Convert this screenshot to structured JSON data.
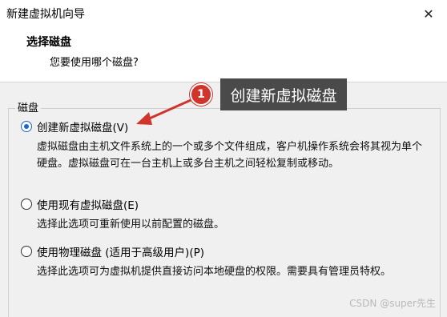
{
  "window": {
    "title": "新建虚拟机向导",
    "close_glyph": "✕"
  },
  "header": {
    "title": "选择磁盘",
    "subtitle": "您要使用哪个磁盘?"
  },
  "group": {
    "label": "磁盘"
  },
  "options": [
    {
      "label": "创建新虚拟磁盘(V)",
      "selected": true,
      "description": "虚拟磁盘由主机文件系统上的一个或多个文件组成，客户机操作系统会将其视为单个硬盘。虚拟磁盘可在一台主机上或多台主机之间轻松复制或移动。"
    },
    {
      "label": "使用现有虚拟磁盘(E)",
      "selected": false,
      "description": "选择此选项可重新使用以前配置的磁盘。"
    },
    {
      "label": "使用物理磁盘 (适用于高级用户)(P)",
      "selected": false,
      "description": "选择此选项可为虚拟机提供直接访问本地硬盘的权限。需要具有管理员特权。"
    }
  ],
  "annotation": {
    "number": "1",
    "text": "创建新虚拟磁盘",
    "color": "#d0342c"
  },
  "watermark": "CSDN @super先生"
}
